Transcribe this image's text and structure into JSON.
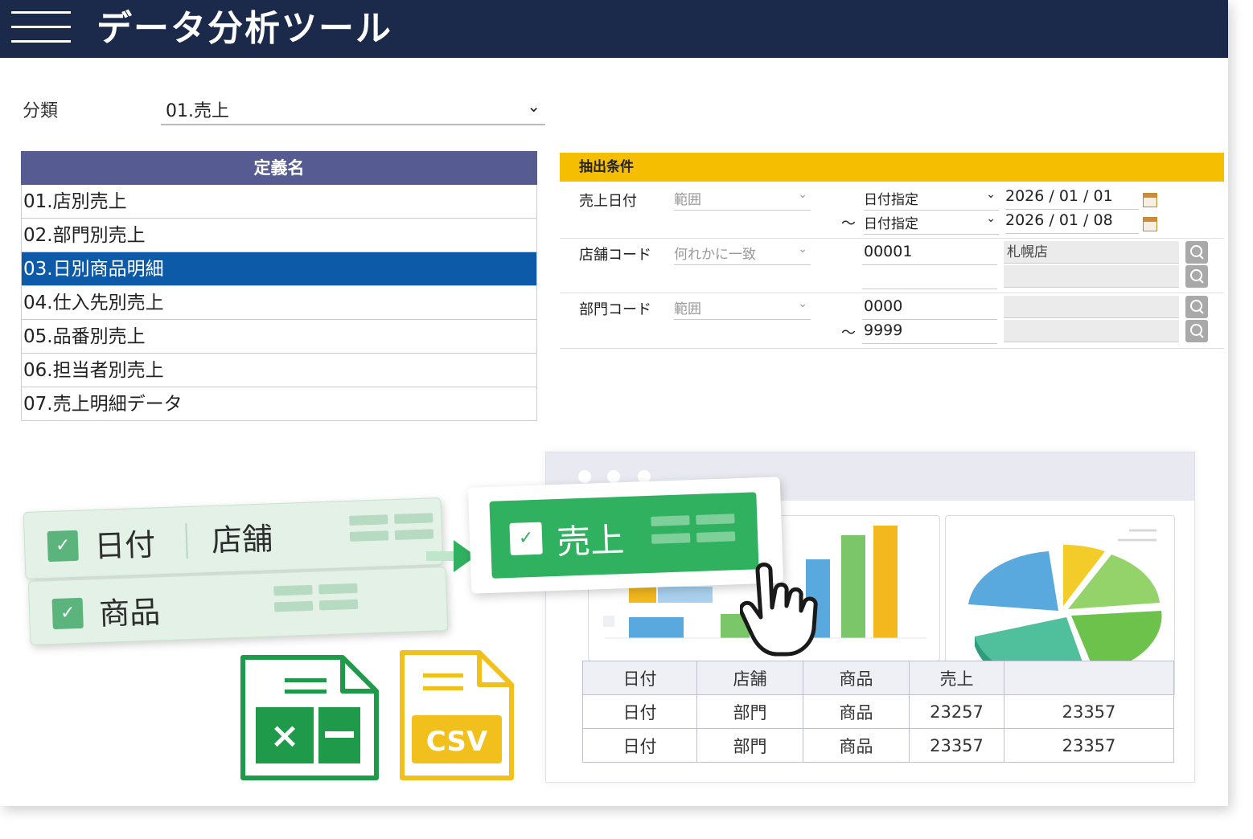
{
  "app": {
    "title": "データ分析ツール"
  },
  "classification": {
    "label": "分類",
    "value": "01.売上"
  },
  "definitions": {
    "header": "定義名",
    "items": [
      {
        "label": "01.店別売上"
      },
      {
        "label": "02.部門別売上"
      },
      {
        "label": "03.日別商品明細"
      },
      {
        "label": "04.仕入先別売上"
      },
      {
        "label": "05.品番別売上"
      },
      {
        "label": "06.担当者別売上"
      },
      {
        "label": "07.売上明細データ"
      }
    ],
    "selected_index": 2
  },
  "conditions": {
    "header": "抽出条件",
    "sales_date": {
      "label": "売上日付",
      "mode": "範囲",
      "from_type": "日付指定",
      "from_date": "2026 / 01 / 01",
      "tilde": "～",
      "to_type": "日付指定",
      "to_date": "2026 / 01 / 08"
    },
    "store_code": {
      "label": "店舗コード",
      "mode": "何れかに一致",
      "code1": "00001",
      "name1": "札幌店"
    },
    "dept_code": {
      "label": "部門コード",
      "mode": "範囲",
      "from": "0000",
      "tilde": "～",
      "to": "9999"
    }
  },
  "features": {
    "date": "日付",
    "store": "店舗",
    "product": "商品",
    "sales": "売上"
  },
  "table": {
    "headers": [
      "日付",
      "店舗",
      "商品",
      "売上",
      ""
    ],
    "rows": [
      [
        "日付",
        "部門",
        "商品",
        "23257",
        "23357"
      ],
      [
        "日付",
        "部門",
        "商品",
        "23357",
        "23357"
      ]
    ]
  },
  "files": {
    "csv_label": "CSV"
  },
  "colors": {
    "topbar": "#1b2a4a",
    "selected": "#0d5ba8",
    "list_header": "#565b91",
    "conditions_header": "#f5be00",
    "green": "#30b160",
    "excel": "#1e9a4a",
    "csv": "#f2c01c"
  },
  "icons": [
    "hamburger-icon",
    "chevron-down-icon",
    "calendar-icon",
    "search-icon",
    "checkbox-icon",
    "arrow-right-icon",
    "hand-pointer-icon",
    "excel-file-icon",
    "csv-file-icon"
  ]
}
